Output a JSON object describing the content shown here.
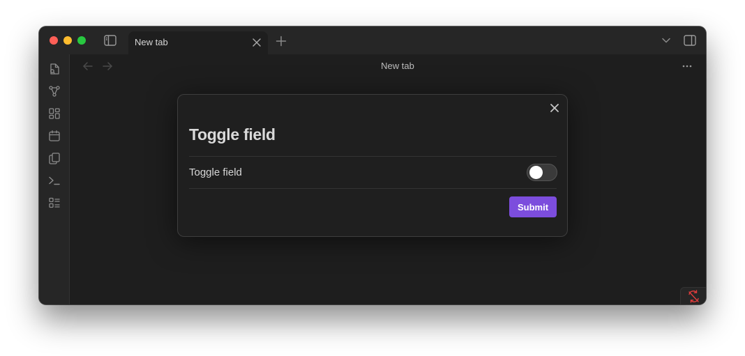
{
  "tab": {
    "label": "New tab"
  },
  "view": {
    "title": "New tab"
  },
  "modal": {
    "title": "Toggle field",
    "setting_label": "Toggle field",
    "toggle_on": false,
    "submit_label": "Submit"
  },
  "icons": {
    "titlebar": [
      "sidebar-toggle-icon",
      "close-tab-icon",
      "plus-icon",
      "chevron-down-icon",
      "right-sidebar-icon"
    ],
    "ribbon": [
      "open-file-icon",
      "graph-icon",
      "canvas-icon",
      "calendar-icon",
      "copy-icon",
      "terminal-icon",
      "checklist-icon"
    ],
    "main": [
      "arrow-left-icon",
      "arrow-right-icon",
      "more-horizontal-icon",
      "sync-disabled-icon"
    ]
  },
  "colors": {
    "accent": "#7c4ddd",
    "background": "#1e1e1e",
    "sync_error": "#e03c3c"
  }
}
